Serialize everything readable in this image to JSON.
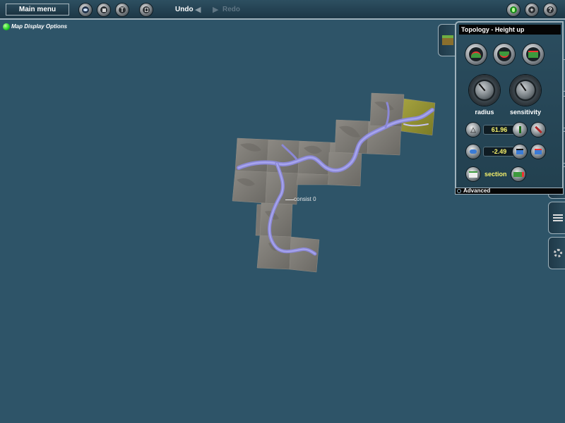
{
  "toolbar": {
    "main_menu_label": "Main menu",
    "undo_label": "Undo",
    "redo_label": "Redo",
    "buttons": {
      "view": "eye-icon",
      "layers": "layers-icon",
      "text": "T",
      "trash": "trash-icon",
      "drivers": "green-person-icon",
      "add": "+",
      "help": "?"
    }
  },
  "map_display_options": {
    "label": "Map Display Options",
    "status_color": "#1fd21f"
  },
  "map": {
    "consist_label": "consist 0"
  },
  "panel": {
    "title": "Topology - Height up",
    "radius_label": "radius",
    "sensitivity_label": "sensitivity",
    "height_value": "61.96",
    "offset_value": "-2.49",
    "section_label": "section",
    "advanced_label": "Advanced",
    "accent_color": "#f7f26b"
  },
  "side_tabs": [
    "scenery-icon",
    "topology-icon",
    "track-icon",
    "train-icon",
    "tools-icon",
    "layers-icon",
    "settings-icon"
  ]
}
